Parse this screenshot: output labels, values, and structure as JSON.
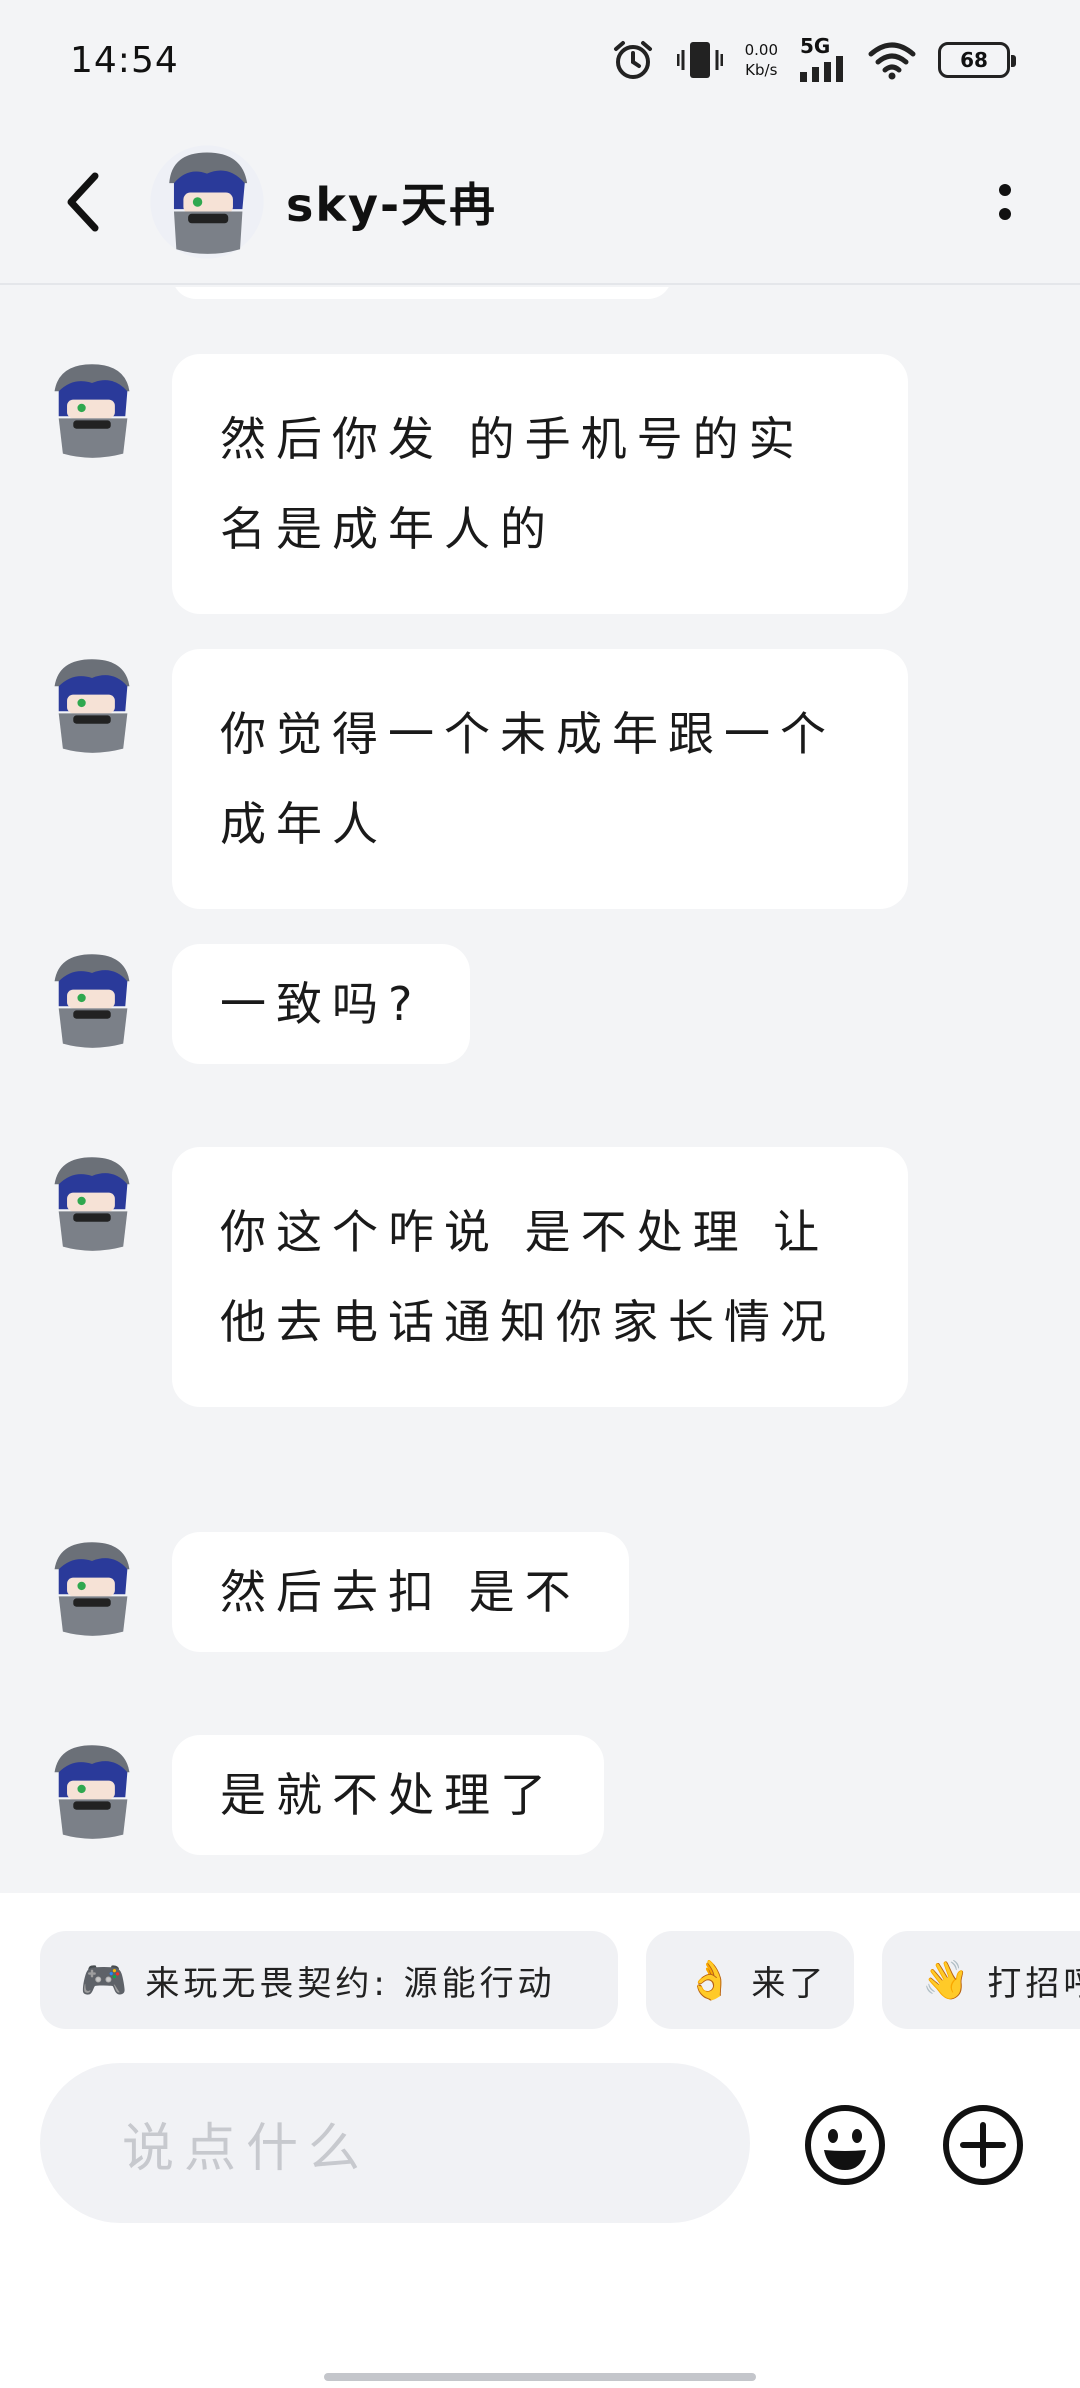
{
  "status_bar": {
    "time": "14:54",
    "net_speed_value": "0.00",
    "net_speed_unit": "Kb/s",
    "network_type": "5G",
    "battery_level": "68",
    "icons": [
      "alarm-icon",
      "vibrate-icon",
      "signal-icon",
      "wifi-icon",
      "battery-icon"
    ]
  },
  "header": {
    "back_icon": "chevron-left-icon",
    "title": "sky-天冉",
    "more_icon": "more-vertical-icon"
  },
  "messages": [
    {
      "sender": "sky-天冉",
      "text": "然后你发 的手机号的实名是成年人的"
    },
    {
      "sender": "sky-天冉",
      "text": "你觉得一个未成年跟一个成年人"
    },
    {
      "sender": "sky-天冉",
      "text": "一致吗?"
    },
    {
      "sender": "sky-天冉",
      "text": "你这个咋说 是不处理 让他去电话通知你家长情况"
    },
    {
      "sender": "sky-天冉",
      "text": "然后去扣 是不"
    },
    {
      "sender": "sky-天冉",
      "text": "是就不处理了"
    }
  ],
  "quick_replies": [
    {
      "icon": "🎮",
      "icon_name": "gamepad-icon",
      "label": "来玩无畏契约: 源能行动"
    },
    {
      "icon": "👌",
      "icon_name": "ok-hand-icon",
      "label": "来了"
    },
    {
      "icon": "👋",
      "icon_name": "wave-icon",
      "label": "打招呼"
    }
  ],
  "composer": {
    "placeholder": "说点什么",
    "emoji_icon": "smiley-icon",
    "plus_icon": "plus-circle-icon"
  },
  "colors": {
    "background": "#f3f4f6",
    "bubble": "#ffffff",
    "chip": "#f0f1f4",
    "placeholder": "#c7c9ce"
  }
}
